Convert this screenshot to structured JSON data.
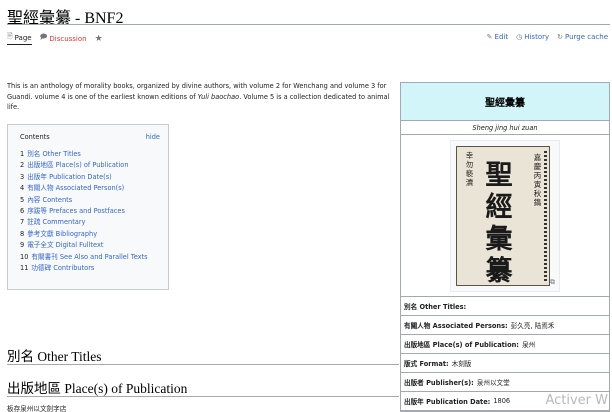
{
  "page": {
    "title": "聖經彙纂 - BNF2",
    "tabs": {
      "page": "Page",
      "discussion": "Discussion"
    },
    "actions": {
      "edit": "Edit",
      "history": "History",
      "purge": "Purge cache"
    }
  },
  "intro": {
    "part1": "This is an anthology of morality books, organized by divine authors, with volume 2 for Wenchang and volume 3 for Guandi. volume 4 is one of the earliest known editions of ",
    "italic": "Yuli baochao",
    "part2": ". Volume 5 is a collection dedicated to animal life."
  },
  "toc": {
    "title": "Contents",
    "hide": "hide",
    "items": [
      {
        "num": "1",
        "label": "別名 Other Titles"
      },
      {
        "num": "2",
        "label": "出版地區 Place(s) of Publication"
      },
      {
        "num": "3",
        "label": "出版年 Publication Date(s)"
      },
      {
        "num": "4",
        "label": "有關人物 Associated Person(s)"
      },
      {
        "num": "5",
        "label": "內容 Contents"
      },
      {
        "num": "6",
        "label": "序跋等 Prefaces and Postfaces"
      },
      {
        "num": "7",
        "label": "註疏 Commentary"
      },
      {
        "num": "8",
        "label": "參考文獻 Bibliography"
      },
      {
        "num": "9",
        "label": "電子全文 Digital Fulltext"
      },
      {
        "num": "10",
        "label": "有關書刊 See Also and Parallel Texts"
      },
      {
        "num": "11",
        "label": "功德碑 Contributors"
      }
    ]
  },
  "sections": {
    "other_titles": "別名 Other Titles",
    "place": "出版地區 Place(s) of Publication",
    "place_text": "板存泉州以文劍字店"
  },
  "infobox": {
    "title": "聖經彙纂",
    "romanization": "Sheng jing hui zuan",
    "cover": {
      "main": [
        "聖",
        "經",
        "彙",
        "纂"
      ],
      "right_top": "嘉慶丙寅秋鐫",
      "left_top": "幸勿褻瀆"
    },
    "rows": [
      {
        "label": "別名 Other Titles:",
        "value": ""
      },
      {
        "label": "有關人物 Associated Persons:",
        "value": "彭久亮, 陆焉禾"
      },
      {
        "label": "出版地區 Place(s) of Publication:",
        "value": "泉州"
      },
      {
        "label": "版式 Format:",
        "value": "木刻版"
      },
      {
        "label": "出版者 Publisher(s):",
        "value": "泉州以文堂"
      },
      {
        "label": "出版年 Publication Date:",
        "value": "1806"
      }
    ]
  },
  "watermark": "Activer W"
}
